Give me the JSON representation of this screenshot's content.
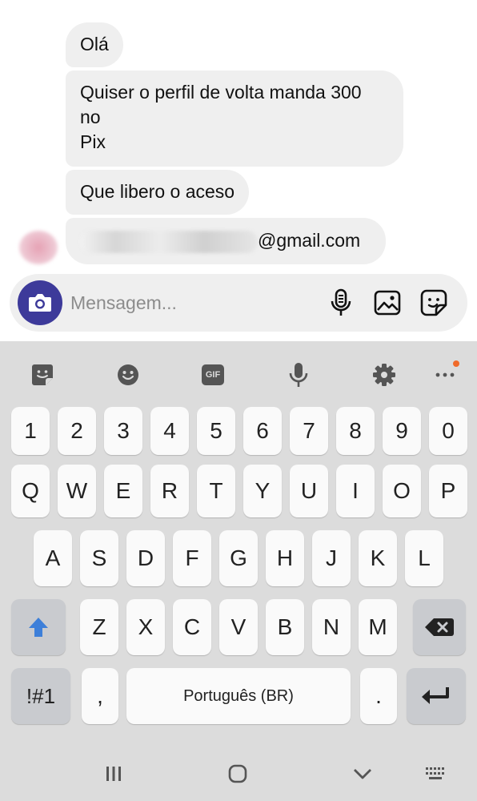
{
  "chat": {
    "messages": [
      {
        "text": "Olá"
      },
      {
        "text": "Quiser o perfil de volta manda 300\nno\nPix"
      },
      {
        "text": "Que libero o aceso"
      },
      {
        "text_visible": "@gmail.com"
      }
    ]
  },
  "composer": {
    "placeholder": "Mensagem...",
    "icons": [
      "camera-icon",
      "microphone-icon",
      "image-icon",
      "sticker-icon"
    ]
  },
  "keyboard": {
    "toolbar": [
      "sticker-icon",
      "emoji-icon",
      "GIF",
      "microphone-icon",
      "settings-icon",
      "more-icon"
    ],
    "toolbar_gif_label": "GIF",
    "rows": {
      "numbers": [
        "1",
        "2",
        "3",
        "4",
        "5",
        "6",
        "7",
        "8",
        "9",
        "0"
      ],
      "row1": [
        "Q",
        "W",
        "E",
        "R",
        "T",
        "Y",
        "U",
        "I",
        "O",
        "P"
      ],
      "row2": [
        "A",
        "S",
        "D",
        "F",
        "G",
        "H",
        "J",
        "K",
        "L"
      ],
      "row3": [
        "Z",
        "X",
        "C",
        "V",
        "B",
        "N",
        "M"
      ]
    },
    "symbols_label": "!#1",
    "comma_label": ",",
    "space_label": "Português (BR)",
    "period_label": ".",
    "accent_color": "#3d7fd9"
  },
  "nav_bar": {
    "icons": [
      "recents-icon",
      "home-icon",
      "back-down-icon",
      "keyboard-switch-icon"
    ]
  }
}
